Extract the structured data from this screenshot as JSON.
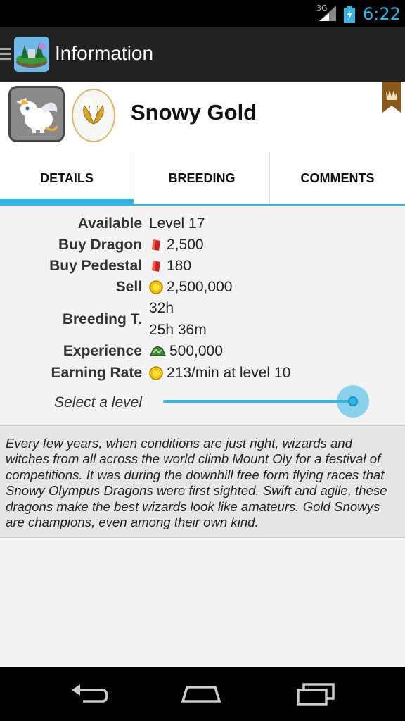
{
  "status_bar": {
    "network": "3G",
    "time": "6:22"
  },
  "action_bar": {
    "title": "Information"
  },
  "dragon": {
    "name": "Snowy Gold"
  },
  "tabs": [
    {
      "label": "DETAILS",
      "selected": true
    },
    {
      "label": "BREEDING",
      "selected": false
    },
    {
      "label": "COMMENTS",
      "selected": false
    }
  ],
  "details": {
    "available": {
      "label": "Available",
      "value": "Level 17"
    },
    "buy_dragon": {
      "label": "Buy Dragon",
      "value": "2,500",
      "icon": "gem-icon"
    },
    "buy_pedestal": {
      "label": "Buy Pedestal",
      "value": "180",
      "icon": "gem-icon"
    },
    "sell": {
      "label": "Sell",
      "value": "2,500,000",
      "icon": "gold-coin-icon"
    },
    "breeding_time": {
      "label": "Breeding T.",
      "value_1": "32h",
      "value_2": "25h 36m"
    },
    "experience": {
      "label": "Experience",
      "value": "500,000",
      "icon": "experience-icon"
    },
    "earning_rate": {
      "label": "Earning Rate",
      "value": "213/min at level 10",
      "icon": "gold-coin-icon"
    }
  },
  "level_selector": {
    "label": "Select a level",
    "position": 1.0
  },
  "description": "Every few years, when conditions are just right, wizards and witches from all across the world climb Mount Oly for a festival of competitions. It was during the downhill free form flying races that Snowy Olympus Dragons were first sighted. Swift and agile, these dragons make the best wizards look like amateurs. Gold Snowys are champions, even among their own kind.",
  "colors": {
    "accent": "#33b5e5",
    "action_bar": "#222222",
    "gem": "#cc1f1f",
    "coin": "#f2c200"
  }
}
